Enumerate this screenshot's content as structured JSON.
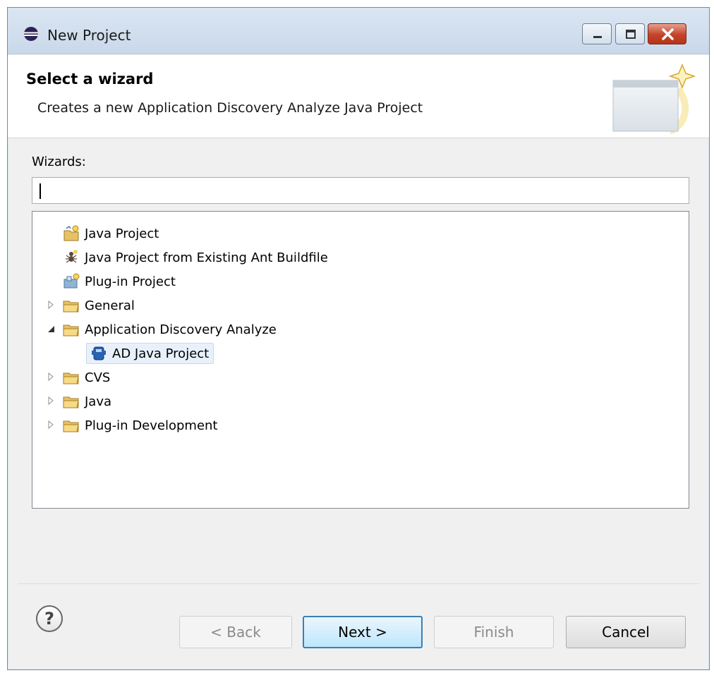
{
  "window": {
    "title": "New Project",
    "controls": {
      "minimize": "minimize",
      "maximize": "maximize",
      "close": "close"
    }
  },
  "header": {
    "title": "Select a wizard",
    "description": "Creates a new Application Discovery Analyze Java Project"
  },
  "filter": {
    "label": "Wizards:",
    "value": "",
    "placeholder": ""
  },
  "tree": {
    "items": [
      {
        "label": "Java Project",
        "icon": "java-project-icon",
        "expandable": false,
        "expanded": false,
        "level": 0
      },
      {
        "label": "Java Project from Existing Ant Buildfile",
        "icon": "ant-icon",
        "expandable": false,
        "expanded": false,
        "level": 0
      },
      {
        "label": "Plug-in Project",
        "icon": "plugin-project-icon",
        "expandable": false,
        "expanded": false,
        "level": 0
      },
      {
        "label": "General",
        "icon": "folder-icon",
        "expandable": true,
        "expanded": false,
        "level": 0
      },
      {
        "label": "Application Discovery Analyze",
        "icon": "folder-icon",
        "expandable": true,
        "expanded": true,
        "level": 0
      },
      {
        "label": "AD Java Project",
        "icon": "ad-project-icon",
        "expandable": false,
        "expanded": false,
        "level": 1,
        "selected": true
      },
      {
        "label": "CVS",
        "icon": "folder-icon",
        "expandable": true,
        "expanded": false,
        "level": 0
      },
      {
        "label": "Java",
        "icon": "folder-icon",
        "expandable": true,
        "expanded": false,
        "level": 0
      },
      {
        "label": "Plug-in Development",
        "icon": "folder-icon",
        "expandable": true,
        "expanded": false,
        "level": 0
      }
    ]
  },
  "footer": {
    "help": "?",
    "back_label": "< Back",
    "next_label": "Next >",
    "finish_label": "Finish",
    "cancel_label": "Cancel"
  },
  "colors": {
    "titlebar": "#c9d8ea",
    "selection": "#e8f1fb",
    "default_button_border": "#3c7fb1",
    "close_button": "#c5432a",
    "folder": "#e8c262"
  }
}
